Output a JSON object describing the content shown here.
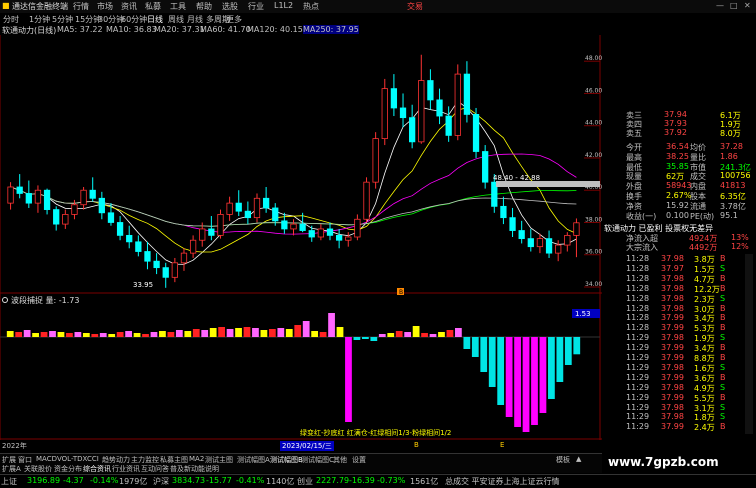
{
  "menubar": {
    "app_title": "通达信金融终端",
    "items": [
      "行情",
      "市场",
      "资讯",
      "私募",
      "工具",
      "帮助",
      "选股",
      "行业",
      "L1L2",
      "热点"
    ],
    "right_label": "交易"
  },
  "periods": [
    "分时",
    "1分钟",
    "5分钟",
    "15分钟",
    "30分钟",
    "60分钟",
    "日线",
    "周线",
    "月线",
    "多周期",
    "更多"
  ],
  "stock": {
    "name_period": "软通动力(日线)",
    "ma": [
      {
        "label": "MA5: 37.22",
        "color": "#ffffff"
      },
      {
        "label": "MA10: 36.83",
        "color": "#ffff00"
      },
      {
        "label": "MA20: 37.31",
        "color": "#ff00ff"
      },
      {
        "label": "MA60: 41.70",
        "color": "#00ff00"
      },
      {
        "label": "MA120: 40.15",
        "color": "#c0c0c0"
      },
      {
        "label": "MA250: 37.95",
        "color": "#0000ff"
      }
    ]
  },
  "main_axis": {
    "ticks": [
      "48.00",
      "46.00",
      "44.00",
      "42.00",
      "40.00",
      "38.00",
      "36.00",
      "34.00"
    ],
    "ylim": [
      34,
      49.5
    ]
  },
  "annotations": {
    "high": "48.40 - 42.88",
    "low": "33.95",
    "marker": "B"
  },
  "indicator": {
    "label": "波段捕捉 量: -1.73",
    "value_tag": "1.53",
    "bottom_text": "绿变红-抄底红 红满仓-红绿相间1/3-粉绿相间1/2"
  },
  "xaxis": {
    "left_label": "2022年",
    "date_label": "2023/02/15/三",
    "b_mark": "B",
    "e_mark": "E"
  },
  "indicator_tabs": [
    "扩展",
    "窗口",
    "MACD",
    "VOL-TDX",
    "CCI",
    "趋势动力",
    "主力监控",
    "私募主图",
    "MA2",
    "测试主图",
    "测试幅图A",
    "测试幅图B",
    "测试幅图C",
    "其他",
    "设置"
  ],
  "bottom_tabs": [
    "扩展A",
    "关联股价",
    "资金分布",
    "综合资讯",
    "行业资讯",
    "互动问答",
    "普及新动能说明"
  ],
  "right_tabs": [
    "模板",
    "▲"
  ],
  "quote": {
    "asks": [
      {
        "label": "卖四",
        "price": "37.93",
        "vol": "1.9万"
      },
      {
        "label": "卖五",
        "price": "37.92",
        "vol": "8.0万"
      }
    ],
    "ask_top": {
      "label": "卖三",
      "price": "37.94",
      "vol": "6.1万"
    },
    "fields": [
      {
        "k": "今开",
        "v": "36.54",
        "k2": "均价",
        "v2": "37.28",
        "c": "#ff4444"
      },
      {
        "k": "最高",
        "v": "38.25",
        "k2": "量比",
        "v2": "1.86",
        "c": "#ff4444"
      },
      {
        "k": "最低",
        "v": "35.85",
        "k2": "市值",
        "v2": "241.3亿",
        "c": "#00ff00"
      },
      {
        "k": "现量",
        "v": "62万",
        "k2": "成交",
        "v2": "100756",
        "c": "#ffff00"
      },
      {
        "k": "外盘",
        "v": "58943",
        "k2": "内盘",
        "v2": "41813",
        "c": "#ff4444"
      },
      {
        "k": "换手",
        "v": "2.67%",
        "k2": "股本",
        "v2": "6.35亿",
        "c": "#ffff00"
      },
      {
        "k": "净资",
        "v": "15.92",
        "k2": "流通",
        "v2": "3.78亿",
        "c": "#c0c0c0"
      },
      {
        "k": "收益(一)",
        "v": "0.100",
        "k2": "PE(动)",
        "v2": "95.1",
        "c": "#c0c0c0"
      }
    ],
    "flow_title": "软通动力 已盈利 投票权无差异",
    "flows": [
      {
        "k": "净流入超",
        "v": "4924万",
        "p": "13%"
      },
      {
        "k": "大宗流入",
        "v": "4492万",
        "p": "12%"
      }
    ],
    "ticks": [
      {
        "t": "11:28",
        "p": "37.98",
        "v": "3.8万",
        "d": "B"
      },
      {
        "t": "11:28",
        "p": "37.97",
        "v": "1.5万",
        "d": "S"
      },
      {
        "t": "11:28",
        "p": "37.98",
        "v": "4.7万",
        "d": "B"
      },
      {
        "t": "11:28",
        "p": "37.98",
        "v": "12.2万",
        "d": "B"
      },
      {
        "t": "11:28",
        "p": "37.98",
        "v": "2.3万",
        "d": "S"
      },
      {
        "t": "11:28",
        "p": "37.98",
        "v": "3.0万",
        "d": "B"
      },
      {
        "t": "11:28",
        "p": "37.99",
        "v": "3.4万",
        "d": "B"
      },
      {
        "t": "11:28",
        "p": "37.99",
        "v": "5.3万",
        "d": "B"
      },
      {
        "t": "11:29",
        "p": "37.98",
        "v": "1.9万",
        "d": "S"
      },
      {
        "t": "11:29",
        "p": "37.99",
        "v": "3.4万",
        "d": "B"
      },
      {
        "t": "11:29",
        "p": "37.99",
        "v": "8.8万",
        "d": "B"
      },
      {
        "t": "11:29",
        "p": "37.98",
        "v": "1.6万",
        "d": "S"
      },
      {
        "t": "11:29",
        "p": "37.99",
        "v": "3.6万",
        "d": "B"
      },
      {
        "t": "11:29",
        "p": "37.98",
        "v": "4.9万",
        "d": "S"
      },
      {
        "t": "11:29",
        "p": "37.99",
        "v": "5.5万",
        "d": "B"
      },
      {
        "t": "11:29",
        "p": "37.98",
        "v": "3.1万",
        "d": "S"
      },
      {
        "t": "11:29",
        "p": "37.98",
        "v": "1.8万",
        "d": "S"
      },
      {
        "t": "11:29",
        "p": "37.99",
        "v": "2.4万",
        "d": "B"
      }
    ]
  },
  "status": [
    {
      "label": "上证",
      "value": "3196.89",
      "chg": "-4.37",
      "pct": "-0.14%",
      "amt": "1979亿"
    },
    {
      "label": "沪深",
      "value": "3834.73",
      "chg": "-15.77",
      "pct": "-0.41%",
      "amt": "1140亿"
    },
    {
      "label": "创业",
      "value": "2227.79",
      "chg": "-16.39",
      "pct": "-0.73%",
      "amt": "1561亿"
    }
  ],
  "status_right": "总成交 平安证券上海上证云行情",
  "watermark": "www.7gpzb.com",
  "colors": {
    "up": "#ff3333",
    "down": "#00ffff",
    "bg": "#000000"
  },
  "chart_data": [
    {
      "type": "candlestick",
      "title": "软通动力(日线)",
      "ylim": [
        34,
        49.5
      ],
      "ohlc": [
        [
          39.2,
          40.5,
          38.8,
          40.2
        ],
        [
          40.2,
          41.0,
          39.5,
          39.8
        ],
        [
          39.8,
          40.6,
          38.9,
          39.2
        ],
        [
          39.2,
          40.3,
          38.6,
          40.0
        ],
        [
          40.0,
          40.1,
          38.5,
          38.8
        ],
        [
          38.8,
          39.0,
          37.5,
          37.9
        ],
        [
          37.9,
          38.8,
          37.6,
          38.5
        ],
        [
          38.5,
          39.4,
          38.2,
          39.1
        ],
        [
          39.1,
          40.2,
          38.8,
          40.0
        ],
        [
          40.0,
          40.8,
          39.3,
          39.5
        ],
        [
          39.5,
          39.9,
          38.2,
          38.6
        ],
        [
          38.6,
          39.2,
          37.8,
          38.0
        ],
        [
          38.0,
          38.4,
          36.9,
          37.2
        ],
        [
          37.2,
          37.8,
          36.4,
          36.8
        ],
        [
          36.8,
          37.2,
          35.9,
          36.2
        ],
        [
          36.2,
          36.8,
          35.1,
          35.6
        ],
        [
          35.6,
          36.1,
          34.8,
          35.2
        ],
        [
          35.2,
          35.5,
          33.95,
          34.6
        ],
        [
          34.6,
          35.8,
          34.3,
          35.5
        ],
        [
          35.5,
          36.4,
          35.0,
          36.1
        ],
        [
          36.1,
          37.2,
          35.8,
          36.9
        ],
        [
          36.9,
          38.0,
          36.5,
          37.6
        ],
        [
          37.6,
          38.4,
          36.9,
          37.2
        ],
        [
          37.2,
          38.8,
          37.0,
          38.5
        ],
        [
          38.5,
          39.6,
          38.1,
          39.2
        ],
        [
          39.2,
          40.0,
          38.4,
          38.7
        ],
        [
          38.7,
          39.3,
          37.9,
          38.3
        ],
        [
          38.3,
          39.8,
          38.0,
          39.5
        ],
        [
          39.5,
          40.2,
          38.6,
          38.9
        ],
        [
          38.9,
          39.2,
          37.8,
          38.1
        ],
        [
          38.1,
          38.6,
          37.3,
          37.6
        ],
        [
          37.6,
          38.2,
          37.2,
          37.9
        ],
        [
          37.9,
          38.6,
          37.4,
          37.5
        ],
        [
          37.5,
          37.8,
          36.8,
          37.1
        ],
        [
          37.1,
          37.9,
          36.9,
          37.6
        ],
        [
          37.6,
          38.0,
          36.9,
          37.2
        ],
        [
          37.2,
          37.6,
          36.4,
          36.9
        ],
        [
          36.9,
          37.4,
          36.5,
          37.1
        ],
        [
          37.1,
          38.5,
          36.9,
          38.2
        ],
        [
          38.2,
          40.8,
          38.0,
          40.5
        ],
        [
          40.5,
          43.6,
          40.1,
          43.2
        ],
        [
          43.2,
          46.9,
          42.8,
          46.3
        ],
        [
          46.3,
          47.2,
          44.6,
          45.1
        ],
        [
          45.1,
          46.0,
          43.9,
          44.5
        ],
        [
          44.5,
          45.3,
          42.6,
          43.0
        ],
        [
          43.0,
          48.4,
          42.88,
          46.8
        ],
        [
          46.8,
          47.5,
          45.0,
          45.6
        ],
        [
          45.6,
          46.3,
          44.1,
          44.6
        ],
        [
          44.6,
          45.2,
          43.0,
          43.4
        ],
        [
          43.4,
          47.8,
          43.1,
          47.2
        ],
        [
          47.2,
          48.0,
          44.2,
          44.7
        ],
        [
          44.7,
          45.1,
          42.0,
          42.4
        ],
        [
          42.4,
          42.8,
          40.1,
          40.5
        ],
        [
          40.5,
          41.0,
          38.6,
          39.0
        ],
        [
          39.0,
          39.6,
          37.9,
          38.3
        ],
        [
          38.3,
          38.9,
          37.1,
          37.5
        ],
        [
          37.5,
          38.1,
          36.7,
          37.0
        ],
        [
          37.0,
          37.6,
          36.2,
          36.5
        ],
        [
          36.5,
          37.3,
          36.1,
          37.0
        ],
        [
          37.0,
          37.5,
          35.8,
          36.1
        ],
        [
          36.1,
          36.9,
          35.6,
          36.6
        ],
        [
          36.6,
          37.4,
          36.2,
          37.2
        ],
        [
          37.2,
          38.25,
          35.85,
          37.98
        ]
      ],
      "ma_series": [
        {
          "name": "MA5",
          "color": "#ffffff"
        },
        {
          "name": "MA10",
          "color": "#ffff00"
        },
        {
          "name": "MA20",
          "color": "#ff00ff"
        },
        {
          "name": "MA60",
          "color": "#00ff00"
        },
        {
          "name": "MA120",
          "color": "#c0c0c0"
        }
      ]
    },
    {
      "type": "bar",
      "title": "波段捕捉",
      "values": [
        0.6,
        0.5,
        0.7,
        0.4,
        0.5,
        0.6,
        0.5,
        0.4,
        0.5,
        0.4,
        0.3,
        0.4,
        0.3,
        0.5,
        0.6,
        0.4,
        0.3,
        0.5,
        0.6,
        0.5,
        0.7,
        0.6,
        0.8,
        0.7,
        0.9,
        1.0,
        0.8,
        0.9,
        1.0,
        0.9,
        0.7,
        0.8,
        0.9,
        0.8,
        1.2,
        1.6,
        0.6,
        0.5,
        2.4,
        1.0,
        -8.5,
        -0.3,
        -0.2,
        -0.4,
        0.3,
        0.4,
        0.6,
        0.5,
        1.1,
        0.4,
        0.3,
        0.5,
        0.7,
        0.9,
        -1.2,
        -2.0,
        -3.5,
        -5.0,
        -6.8,
        -8.0,
        -9.0,
        -9.5,
        -8.8,
        -7.6,
        -6.2,
        -4.5,
        -2.8,
        -1.73
      ],
      "ylim": [
        -10,
        3
      ]
    }
  ]
}
